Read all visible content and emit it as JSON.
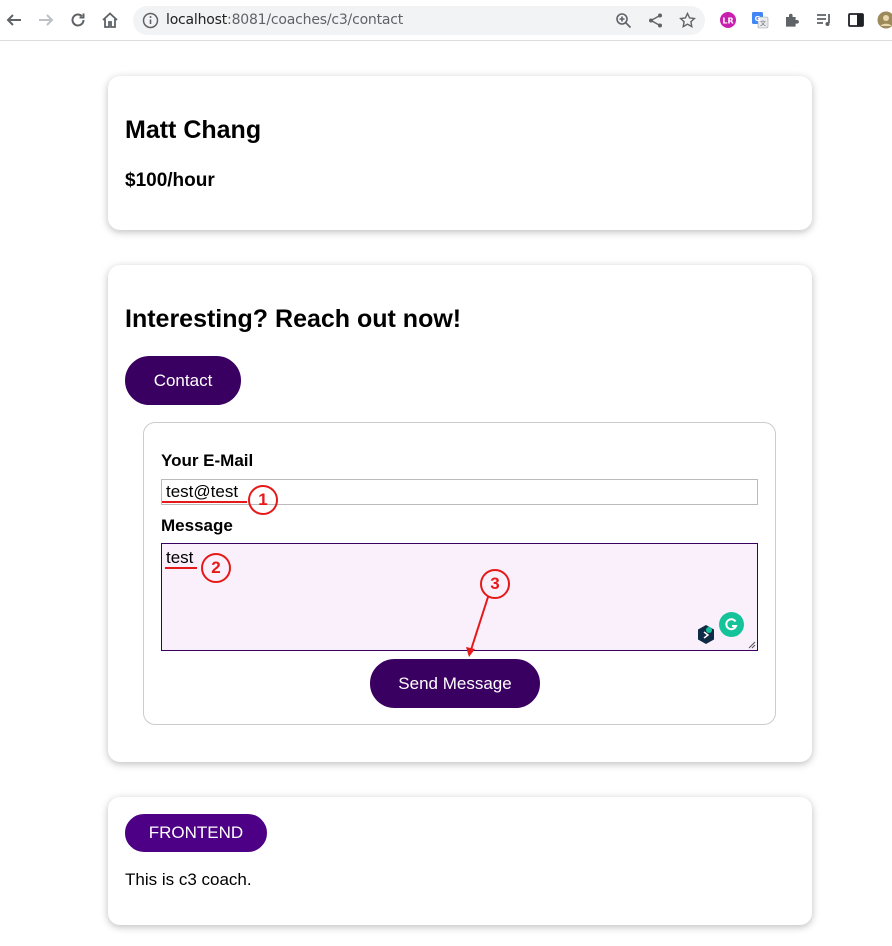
{
  "browser": {
    "url_host": "localhost",
    "url_path": ":8081/coaches/c3/contact"
  },
  "coach": {
    "name": "Matt Chang",
    "rate": "$100/hour"
  },
  "contact": {
    "title": "Interesting? Reach out now!",
    "contact_button": "Contact",
    "form": {
      "email_label": "Your E-Mail",
      "email_value": "test@test",
      "message_label": "Message",
      "message_value": "test",
      "send_button": "Send Message"
    }
  },
  "annotations": [
    "1",
    "2",
    "3"
  ],
  "tags": [
    "FRONTEND"
  ],
  "description": "This is c3 coach.",
  "colors": {
    "primary": "#3a0061",
    "tag": "#4d0085",
    "annotation": "#e61919"
  }
}
